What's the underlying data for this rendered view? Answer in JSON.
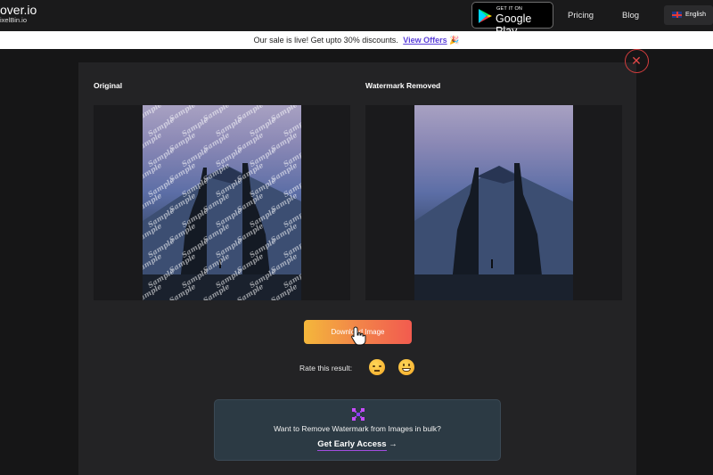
{
  "header": {
    "brand_name": "over.io",
    "brand_sub": "ixelBin.io",
    "google_play_small": "GET IT ON",
    "google_play_big": "Google Play",
    "nav_pricing": "Pricing",
    "nav_blog": "Blog",
    "language": "English"
  },
  "banner": {
    "text": "Our sale is live! Get upto 30% discounts.",
    "link": "View Offers",
    "emoji": "🎉"
  },
  "result": {
    "original_label": "Original",
    "removed_label": "Watermark Removed",
    "watermark_text": "Sample",
    "close_icon": "✕",
    "download_label": "Download Image",
    "rate_label": "Rate this result:",
    "rating_options": [
      "unamused-face-icon",
      "grinning-face-icon"
    ]
  },
  "bulk": {
    "text": "Want to Remove Watermark from Images in bulk?",
    "cta": "Get Early Access",
    "cta_arrow": "→"
  },
  "colors": {
    "accent_purple": "#5a3fd9",
    "close_red": "#d43d3d",
    "button_gradient": [
      "#f4b73b",
      "#f25b4f"
    ]
  }
}
